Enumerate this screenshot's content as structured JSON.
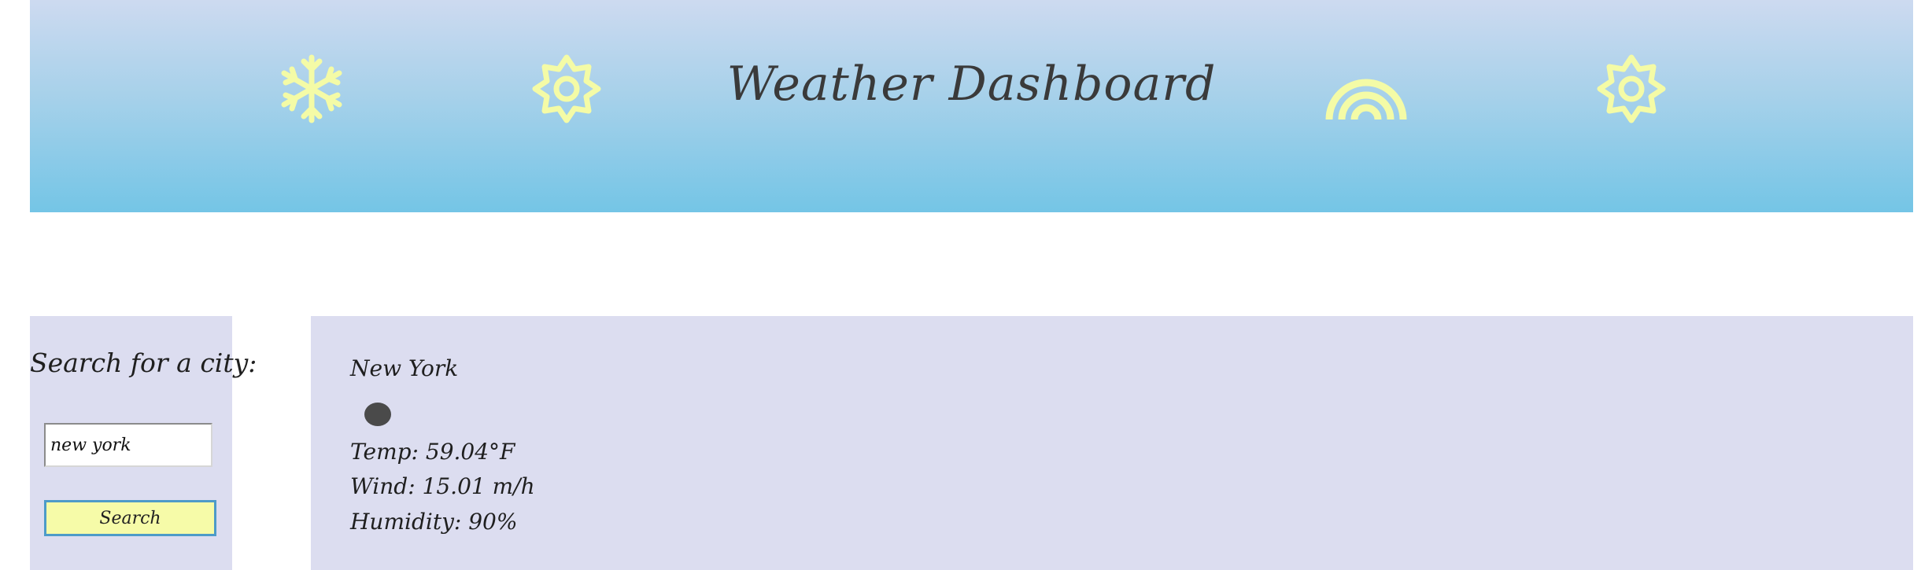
{
  "header": {
    "title": "Weather Dashboard",
    "icons": [
      "snowflake-icon",
      "sun-icon",
      "rainbow-icon",
      "sun-icon"
    ],
    "icon_color": "#f4fba6"
  },
  "sidebar": {
    "heading": "Search for a city:",
    "input_value": "new york",
    "button_label": "Search"
  },
  "current": {
    "city": "New York",
    "temp": "Temp: 59.04°F",
    "wind": "Wind: 15.01 m/h",
    "humidity": "Humidity: 90%"
  },
  "colors": {
    "panel_bg": "#dcddf0",
    "button_bg": "#f6fba8",
    "button_border": "#4d9bc8"
  }
}
